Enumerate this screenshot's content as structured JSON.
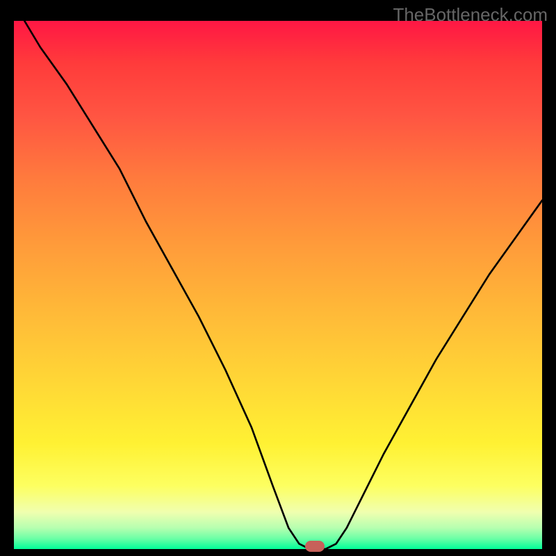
{
  "watermark": "TheBottleneck.com",
  "chart_data": {
    "type": "line",
    "title": "",
    "xlabel": "",
    "ylabel": "",
    "xlim": [
      0,
      100
    ],
    "ylim": [
      0,
      100
    ],
    "series": [
      {
        "name": "bottleneck-curve",
        "x": [
          2,
          5,
          10,
          15,
          20,
          25,
          30,
          35,
          40,
          45,
          49,
          52,
          54,
          56,
          58,
          59,
          61,
          63,
          66,
          70,
          75,
          80,
          85,
          90,
          95,
          100
        ],
        "values": [
          100,
          95,
          88,
          80,
          72,
          62,
          53,
          44,
          34,
          23,
          12,
          4,
          1,
          0,
          0,
          0,
          1,
          4,
          10,
          18,
          27,
          36,
          44,
          52,
          59,
          66
        ]
      }
    ],
    "annotations": [
      {
        "name": "optimal-marker",
        "x": 57,
        "y": 0.5
      }
    ]
  }
}
